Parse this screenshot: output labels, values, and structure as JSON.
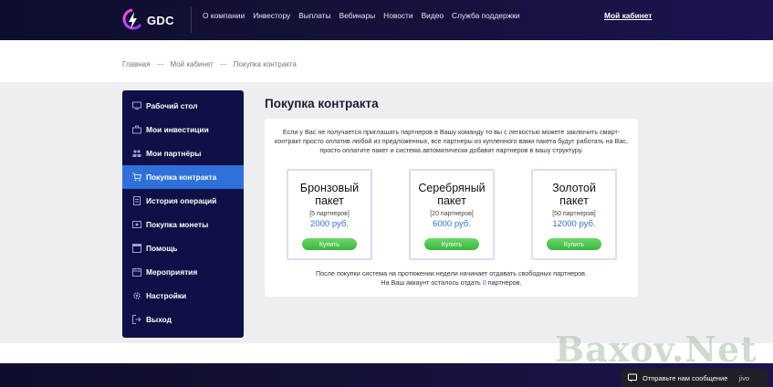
{
  "header": {
    "logo_text": "GDC",
    "nav": [
      "О компании",
      "Инвестору",
      "Выплаты",
      "Вебинары",
      "Новости",
      "Видео",
      "Служба поддержки"
    ],
    "cabinet_link": "Мой кабинет"
  },
  "breadcrumb": {
    "items": [
      "Главная",
      "Мой кабинет",
      "Покупка контракта"
    ],
    "separator": "—"
  },
  "sidebar": {
    "items": [
      {
        "label": "Рабочий стол",
        "icon": "monitor-icon",
        "active": false
      },
      {
        "label": "Мои инвестиции",
        "icon": "briefcase-icon",
        "active": false
      },
      {
        "label": "Мои партнёры",
        "icon": "users-icon",
        "active": false
      },
      {
        "label": "Покупка контракта",
        "icon": "cart-icon",
        "active": true
      },
      {
        "label": "История операций",
        "icon": "document-icon",
        "active": false
      },
      {
        "label": "Покупка монеты",
        "icon": "coin-icon",
        "active": false
      },
      {
        "label": "Помощь",
        "icon": "help-icon",
        "active": false
      },
      {
        "label": "Мероприятия",
        "icon": "calendar-icon",
        "active": false
      },
      {
        "label": "Настройки",
        "icon": "gear-icon",
        "active": false
      },
      {
        "label": "Выход",
        "icon": "logout-icon",
        "active": false
      }
    ]
  },
  "main": {
    "title": "Покупка контракта",
    "intro": "Если у Вас не получается приглашать партнеров в Вашу команду то вы с легкостью можете заключить смарт-контракт просто оплатив любой из предложенных, все партнеры из купленного вами пакета будут работать на Вас, просто оплатите пакет и система автоматически добавит партнеров в вашу структуру.",
    "packages": [
      {
        "name_line1": "Бронзовый",
        "name_line2": "пакет",
        "partners": "[5 партнеров]",
        "price": "2000 руб.",
        "button": "Купить"
      },
      {
        "name_line1": "Серебряный",
        "name_line2": "пакет",
        "partners": "[20 партнеров]",
        "price": "6000 руб.",
        "button": "Купить"
      },
      {
        "name_line1": "Золотой",
        "name_line2": "пакет",
        "partners": "[50 партнеров]",
        "price": "12000 руб.",
        "button": "Купить"
      }
    ],
    "footnote_line1": "После покупки система на протяжении недели начинает отдавать свободных партнеров.",
    "footnote_line2_pre": "На Ваш аккаунт осталось отдать",
    "footnote_line2_count": "0",
    "footnote_line2_post": "партнеров."
  },
  "watermark": "Baxov.Net",
  "chat": {
    "label": "Отправьте нам сообщение",
    "brand": "jivo"
  },
  "colors": {
    "header_bg": "#141238",
    "sidebar_bg": "#0f1045",
    "active_item": "#2f71d9",
    "buy_button": "#45c046",
    "price": "#2f71d9"
  }
}
